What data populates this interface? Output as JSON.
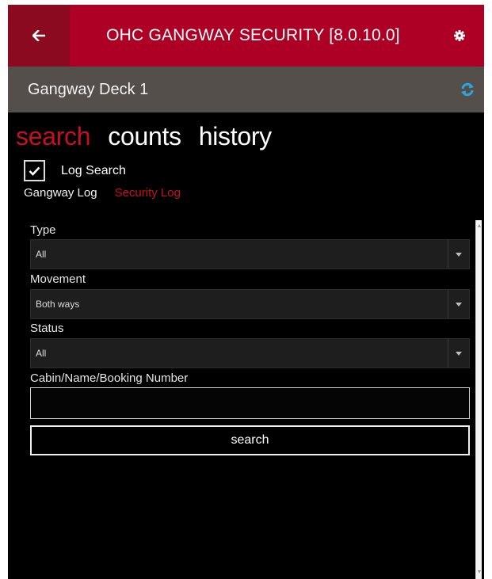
{
  "header": {
    "title": "OHC GANGWAY SECURITY [8.0.10.0]",
    "back_icon": "arrow-left-icon",
    "settings_icon": "gear-icon",
    "bg_color": "#ae0025",
    "back_bg_color": "#8c0a1f"
  },
  "subheader": {
    "title": "Gangway Deck 1",
    "refresh_icon": "refresh-icon",
    "bg_color": "#554f4b"
  },
  "pivot": {
    "tabs": [
      {
        "label": "search",
        "active": true
      },
      {
        "label": "counts",
        "active": false
      },
      {
        "label": "history",
        "active": false
      }
    ],
    "accent_color": "#c7101f"
  },
  "log_search": {
    "label": "Log Search",
    "checked": true
  },
  "log_tabs": [
    {
      "label": "Gangway Log",
      "active": false
    },
    {
      "label": "Security Log",
      "active": true
    }
  ],
  "form": {
    "type": {
      "label": "Type",
      "value": "All"
    },
    "movement": {
      "label": "Movement",
      "value": "Both ways"
    },
    "status": {
      "label": "Status",
      "value": "All"
    },
    "query": {
      "label": "Cabin/Name/Booking Number",
      "value": "",
      "placeholder": ""
    },
    "search_button": "search"
  }
}
